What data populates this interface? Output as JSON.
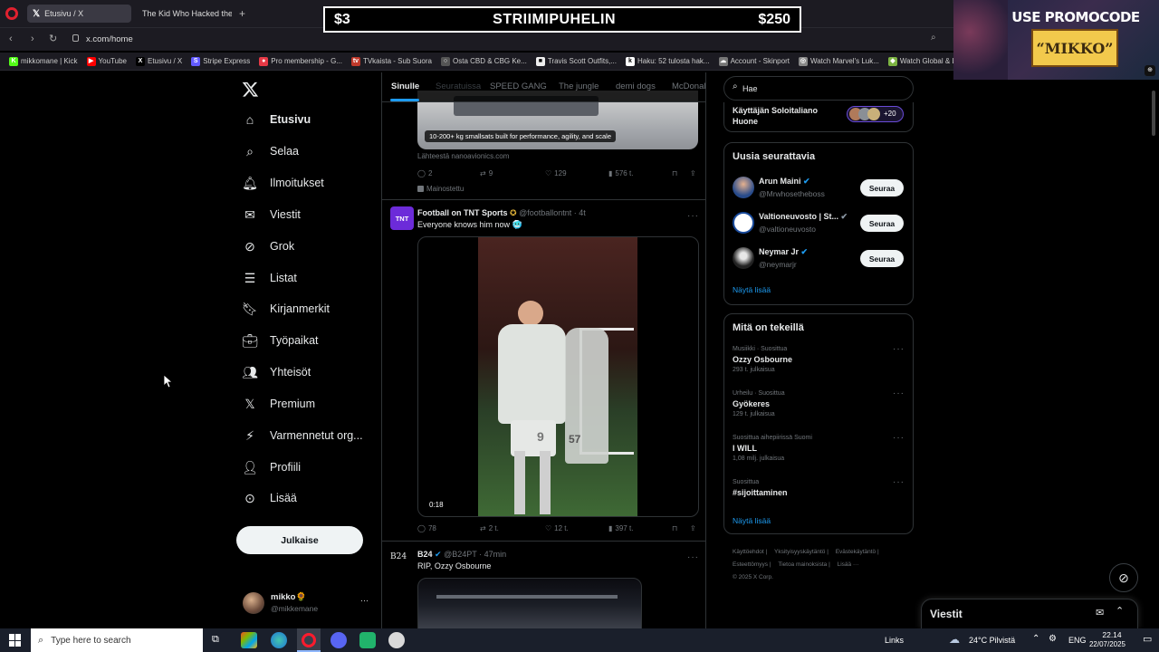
{
  "browser": {
    "tabs": [
      {
        "label": "Etusivu / X",
        "active": true
      },
      {
        "label": "The Kid Who Hacked the",
        "active": false
      }
    ],
    "url": "x.com/home",
    "bookmarks": [
      {
        "label": "mikkomane | Kick",
        "color": "#53fc18",
        "glyph": "K"
      },
      {
        "label": "YouTube",
        "color": "#ff0000",
        "glyph": "▶"
      },
      {
        "label": "Etusivu / X",
        "color": "#000000",
        "glyph": "X"
      },
      {
        "label": "Stripe Express",
        "color": "#635bff",
        "glyph": "S"
      },
      {
        "label": "Pro membership - G...",
        "color": "#e63946",
        "glyph": "●"
      },
      {
        "label": "TVkaista - Sub Suora",
        "color": "#c0392b",
        "glyph": "tv"
      },
      {
        "label": "Osta CBD & CBG Ke...",
        "color": "#555555",
        "glyph": "○"
      },
      {
        "label": "Travis Scott Outfits,...",
        "color": "#eeeeee",
        "glyph": "■"
      },
      {
        "label": "Haku: 52 tulosta hak...",
        "color": "#ffffff",
        "glyph": "k"
      },
      {
        "label": "Account - Skinport",
        "color": "#777777",
        "glyph": "☁"
      },
      {
        "label": "Watch Marvel's Luk...",
        "color": "#888888",
        "glyph": "◎"
      },
      {
        "label": "Watch Global & Loc...",
        "color": "#7cb342",
        "glyph": "◆"
      }
    ]
  },
  "overlay": {
    "left_amount": "$3",
    "title": "STRIIMIPUHELIN",
    "right_amount": "$250",
    "promo_line1": "USE PROMOCODE",
    "promo_line2": "“MIKKO”"
  },
  "sidebar": {
    "items": [
      {
        "label": "Etusivu",
        "icon": "home-icon",
        "active": true
      },
      {
        "label": "Selaa",
        "icon": "search-icon"
      },
      {
        "label": "Ilmoitukset",
        "icon": "bell-icon"
      },
      {
        "label": "Viestit",
        "icon": "mail-icon"
      },
      {
        "label": "Grok",
        "icon": "grok-icon"
      },
      {
        "label": "Listat",
        "icon": "list-icon"
      },
      {
        "label": "Kirjanmerkit",
        "icon": "bookmark-icon"
      },
      {
        "label": "Työpaikat",
        "icon": "briefcase-icon"
      },
      {
        "label": "Yhteisöt",
        "icon": "communities-icon"
      },
      {
        "label": "Premium",
        "icon": "x-logo-icon"
      },
      {
        "label": "Varmennetut org...",
        "icon": "lightning-icon"
      },
      {
        "label": "Profiili",
        "icon": "person-icon"
      },
      {
        "label": "Lisää",
        "icon": "more-circle-icon"
      }
    ],
    "post_button": "Julkaise",
    "account": {
      "name": "mikko🌻",
      "handle": "@mikkemane",
      "more": "···"
    }
  },
  "feed": {
    "tabs": [
      "Sinulle",
      "Seuratuissa",
      "SPEED GANG",
      "The jungle",
      "demi dogs",
      "McDonal"
    ],
    "ad_post": {
      "image_caption": "10-200+ kg smallsats built for performance, agility, and scale",
      "source": "Lähteestä nanoavionics.com",
      "replies": "2",
      "reposts": "9",
      "likes": "129",
      "views": "576 t.",
      "promoted": "Mainostettu"
    },
    "post1": {
      "avatar_text": "TNT",
      "author": "Football on TNT Sports",
      "handle": "@footballontnt · 4t",
      "text": "Everyone knows him now 🥶",
      "duration": "0:18",
      "replies": "78",
      "reposts": "2 t.",
      "likes": "12 t.",
      "views": "397 t.",
      "player_number_1": "9",
      "player_number_2": "57"
    },
    "post2": {
      "avatar_text": "B24",
      "author": "B24",
      "handle": "@B24PT · 47min",
      "text": "RIP, Ozzy Osbourne"
    }
  },
  "right": {
    "search": {
      "value": "Hae"
    },
    "space": {
      "title": "Käyttäjän Soloitaliano Huone",
      "count": "+20"
    },
    "who_to_follow": {
      "title": "Uusia seurattavia",
      "users": [
        {
          "name": "Arun Maini",
          "handle": "@Mrwhosetheboss",
          "button": "Seuraa"
        },
        {
          "name": "Valtioneuvosto | St...",
          "handle": "@valtioneuvosto",
          "button": "Seuraa"
        },
        {
          "name": "Neymar Jr",
          "handle": "@neymarjr",
          "button": "Seuraa"
        }
      ],
      "show_more": "Näytä lisää"
    },
    "trends": {
      "title": "Mitä on tekeillä",
      "items": [
        {
          "meta": "Musiikki · Suosittua",
          "title": "Ozzy Osbourne",
          "count": "293 t. julkaisua"
        },
        {
          "meta": "Urheilu · Suosittua",
          "title": "Gyökeres",
          "count": "129 t. julkaisua"
        },
        {
          "meta": "Suosittua aihepiirissä Suomi",
          "title": "I WILL",
          "count": "1,08 milj. julkaisua"
        },
        {
          "meta": "Suosittua",
          "title": "#sijoittaminen",
          "count": ""
        }
      ],
      "show_more": "Näytä lisää"
    },
    "footer": [
      "Käyttöehdot",
      "Yksityisyyskäytäntö",
      "Evästekäytäntö",
      "Esteettömyys",
      "Tietoa mainoksista",
      "Lisää ···",
      "© 2025 X Corp."
    ],
    "messages_label": "Viestit"
  },
  "taskbar": {
    "search_placeholder": "Type here to search",
    "links": "Links",
    "weather": "24°C  Pilvistä",
    "lang": "ENG",
    "time": "22.14",
    "date": "22/07/2025"
  },
  "colors": {
    "accent": "#1d9bf0",
    "background": "#000000",
    "border": "#2f3336",
    "muted": "#71767b",
    "verified": "#1d9bf0",
    "tnt_brand": "#6c2bd9"
  }
}
